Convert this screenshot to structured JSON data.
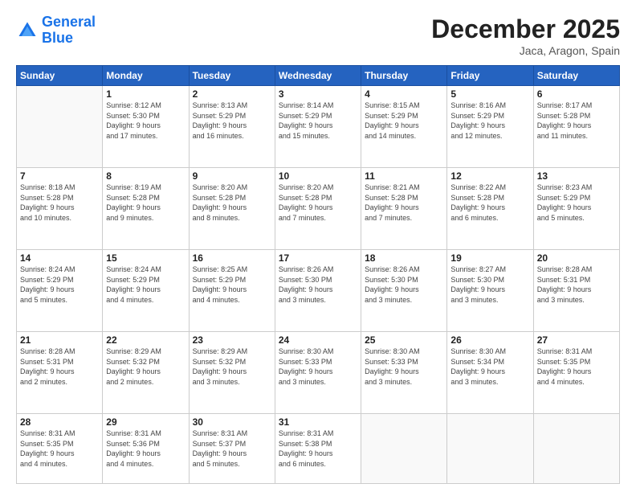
{
  "logo": {
    "line1": "General",
    "line2": "Blue"
  },
  "header": {
    "month": "December 2025",
    "location": "Jaca, Aragon, Spain"
  },
  "weekdays": [
    "Sunday",
    "Monday",
    "Tuesday",
    "Wednesday",
    "Thursday",
    "Friday",
    "Saturday"
  ],
  "weeks": [
    [
      {
        "day": "",
        "info": ""
      },
      {
        "day": "1",
        "info": "Sunrise: 8:12 AM\nSunset: 5:30 PM\nDaylight: 9 hours\nand 17 minutes."
      },
      {
        "day": "2",
        "info": "Sunrise: 8:13 AM\nSunset: 5:29 PM\nDaylight: 9 hours\nand 16 minutes."
      },
      {
        "day": "3",
        "info": "Sunrise: 8:14 AM\nSunset: 5:29 PM\nDaylight: 9 hours\nand 15 minutes."
      },
      {
        "day": "4",
        "info": "Sunrise: 8:15 AM\nSunset: 5:29 PM\nDaylight: 9 hours\nand 14 minutes."
      },
      {
        "day": "5",
        "info": "Sunrise: 8:16 AM\nSunset: 5:29 PM\nDaylight: 9 hours\nand 12 minutes."
      },
      {
        "day": "6",
        "info": "Sunrise: 8:17 AM\nSunset: 5:28 PM\nDaylight: 9 hours\nand 11 minutes."
      }
    ],
    [
      {
        "day": "7",
        "info": "Sunrise: 8:18 AM\nSunset: 5:28 PM\nDaylight: 9 hours\nand 10 minutes."
      },
      {
        "day": "8",
        "info": "Sunrise: 8:19 AM\nSunset: 5:28 PM\nDaylight: 9 hours\nand 9 minutes."
      },
      {
        "day": "9",
        "info": "Sunrise: 8:20 AM\nSunset: 5:28 PM\nDaylight: 9 hours\nand 8 minutes."
      },
      {
        "day": "10",
        "info": "Sunrise: 8:20 AM\nSunset: 5:28 PM\nDaylight: 9 hours\nand 7 minutes."
      },
      {
        "day": "11",
        "info": "Sunrise: 8:21 AM\nSunset: 5:28 PM\nDaylight: 9 hours\nand 7 minutes."
      },
      {
        "day": "12",
        "info": "Sunrise: 8:22 AM\nSunset: 5:28 PM\nDaylight: 9 hours\nand 6 minutes."
      },
      {
        "day": "13",
        "info": "Sunrise: 8:23 AM\nSunset: 5:29 PM\nDaylight: 9 hours\nand 5 minutes."
      }
    ],
    [
      {
        "day": "14",
        "info": "Sunrise: 8:24 AM\nSunset: 5:29 PM\nDaylight: 9 hours\nand 5 minutes."
      },
      {
        "day": "15",
        "info": "Sunrise: 8:24 AM\nSunset: 5:29 PM\nDaylight: 9 hours\nand 4 minutes."
      },
      {
        "day": "16",
        "info": "Sunrise: 8:25 AM\nSunset: 5:29 PM\nDaylight: 9 hours\nand 4 minutes."
      },
      {
        "day": "17",
        "info": "Sunrise: 8:26 AM\nSunset: 5:30 PM\nDaylight: 9 hours\nand 3 minutes."
      },
      {
        "day": "18",
        "info": "Sunrise: 8:26 AM\nSunset: 5:30 PM\nDaylight: 9 hours\nand 3 minutes."
      },
      {
        "day": "19",
        "info": "Sunrise: 8:27 AM\nSunset: 5:30 PM\nDaylight: 9 hours\nand 3 minutes."
      },
      {
        "day": "20",
        "info": "Sunrise: 8:28 AM\nSunset: 5:31 PM\nDaylight: 9 hours\nand 3 minutes."
      }
    ],
    [
      {
        "day": "21",
        "info": "Sunrise: 8:28 AM\nSunset: 5:31 PM\nDaylight: 9 hours\nand 2 minutes."
      },
      {
        "day": "22",
        "info": "Sunrise: 8:29 AM\nSunset: 5:32 PM\nDaylight: 9 hours\nand 2 minutes."
      },
      {
        "day": "23",
        "info": "Sunrise: 8:29 AM\nSunset: 5:32 PM\nDaylight: 9 hours\nand 3 minutes."
      },
      {
        "day": "24",
        "info": "Sunrise: 8:30 AM\nSunset: 5:33 PM\nDaylight: 9 hours\nand 3 minutes."
      },
      {
        "day": "25",
        "info": "Sunrise: 8:30 AM\nSunset: 5:33 PM\nDaylight: 9 hours\nand 3 minutes."
      },
      {
        "day": "26",
        "info": "Sunrise: 8:30 AM\nSunset: 5:34 PM\nDaylight: 9 hours\nand 3 minutes."
      },
      {
        "day": "27",
        "info": "Sunrise: 8:31 AM\nSunset: 5:35 PM\nDaylight: 9 hours\nand 4 minutes."
      }
    ],
    [
      {
        "day": "28",
        "info": "Sunrise: 8:31 AM\nSunset: 5:35 PM\nDaylight: 9 hours\nand 4 minutes."
      },
      {
        "day": "29",
        "info": "Sunrise: 8:31 AM\nSunset: 5:36 PM\nDaylight: 9 hours\nand 4 minutes."
      },
      {
        "day": "30",
        "info": "Sunrise: 8:31 AM\nSunset: 5:37 PM\nDaylight: 9 hours\nand 5 minutes."
      },
      {
        "day": "31",
        "info": "Sunrise: 8:31 AM\nSunset: 5:38 PM\nDaylight: 9 hours\nand 6 minutes."
      },
      {
        "day": "",
        "info": ""
      },
      {
        "day": "",
        "info": ""
      },
      {
        "day": "",
        "info": ""
      }
    ]
  ]
}
